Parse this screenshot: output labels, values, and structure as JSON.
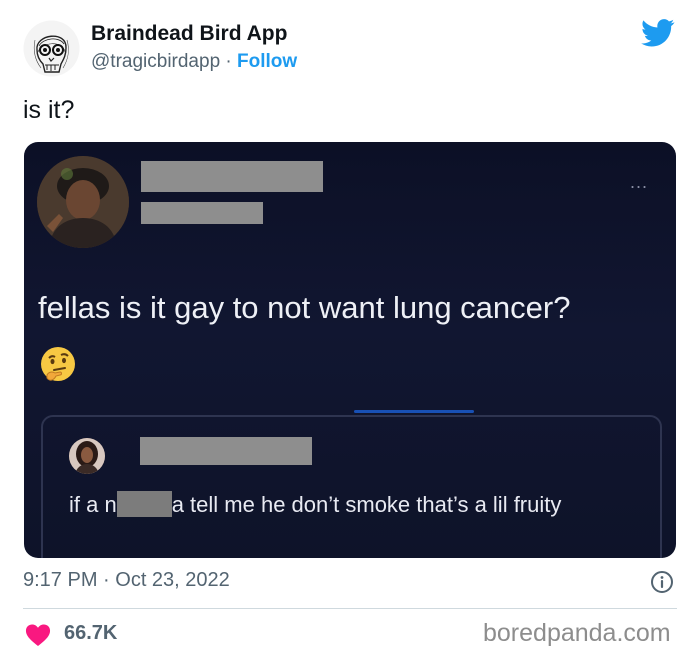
{
  "author": {
    "name": "Braindead Bird App",
    "handle": "@tragicbirdapp",
    "separator": " · ",
    "follow_label": "Follow"
  },
  "tweet": {
    "text": "is it?",
    "timestamp": "9:17 PM · Oct 23, 2022",
    "likes": "66.7K"
  },
  "embedded": {
    "more_label": "...",
    "post_text": "fellas is it gay to not want lung cancer?",
    "quote_text_part1": "if a n",
    "quote_text_part2": "a tell me he don’t smoke that’s a lil fruity"
  },
  "icons": {
    "brand": "twitter-bird-icon",
    "info": "info-icon",
    "like": "heart-icon",
    "emoji": "thinking-face-emoji"
  },
  "colors": {
    "accent": "#1d9bf0",
    "heart": "#f91880",
    "text_secondary": "#536471",
    "embed_bg": "#111631"
  },
  "watermark": "boredpanda.com"
}
